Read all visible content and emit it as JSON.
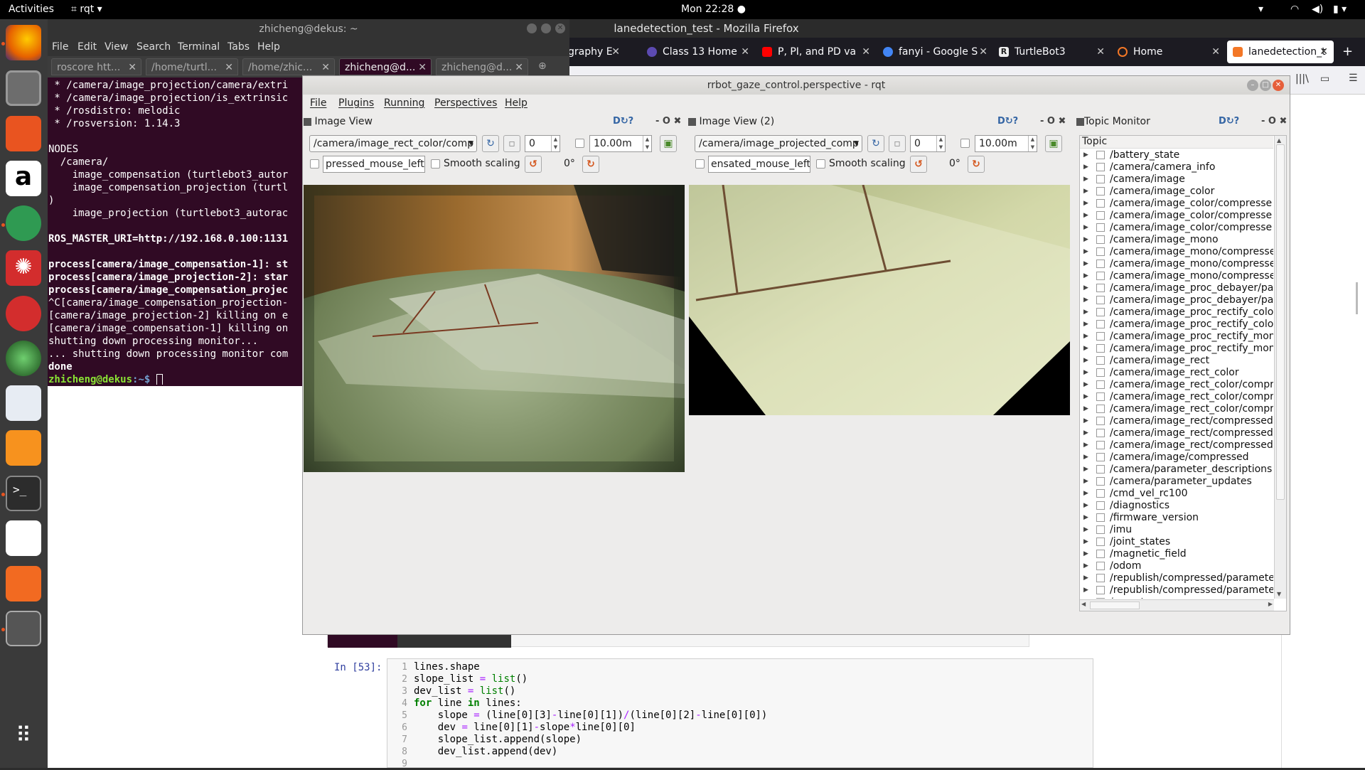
{
  "topbar": {
    "activities": "Activities",
    "app": "rqt",
    "clock": "Mon 22:28 ●"
  },
  "dock": {
    "items": [
      {
        "name": "firefox-icon",
        "color": "#e66000"
      },
      {
        "name": "files-icon",
        "color": "#8a8a8a"
      },
      {
        "name": "software-center-icon",
        "color": "#e95420"
      },
      {
        "name": "amazon-icon",
        "color": "#ffffff"
      },
      {
        "name": "atom-icon",
        "color": "#2f9a52"
      },
      {
        "name": "wolfram-icon",
        "color": "#d32d2d"
      },
      {
        "name": "pdf-reader-icon",
        "color": "#d32d2d"
      },
      {
        "name": "globe-icon",
        "color": "#2d6a2d"
      },
      {
        "name": "gedit-icon",
        "color": "#4a90d9"
      },
      {
        "name": "sublime-icon",
        "color": "#f7921e"
      },
      {
        "name": "terminal-icon",
        "color": "#2c2c2c"
      },
      {
        "name": "text-editor-icon",
        "color": "#ffffff"
      },
      {
        "name": "slides-icon",
        "color": "#f26a21"
      },
      {
        "name": "app-grid-icon",
        "color": "#dddddd"
      }
    ],
    "show_apps": "show-applications-icon"
  },
  "firefox": {
    "title": "lanedetection_test - Mozilla Firefox",
    "tabs": [
      {
        "label": "graphy E",
        "fav": "#666666"
      },
      {
        "label": "Class 13 Home",
        "fav": "#5c4ab1"
      },
      {
        "label": "P, PI, and PD va",
        "fav": "#ff0000"
      },
      {
        "label": "fanyi - Google S",
        "fav": "#4285f4"
      },
      {
        "label": "TurtleBot3",
        "fav": "#222222"
      },
      {
        "label": "Home",
        "fav": "#f37726"
      },
      {
        "label": "lanedetection_t",
        "fav": "#f37726"
      }
    ]
  },
  "terminal": {
    "title": "zhicheng@dekus: ~",
    "menu": [
      "File",
      "Edit",
      "View",
      "Search",
      "Terminal",
      "Tabs",
      "Help"
    ],
    "tabs": [
      "roscore htt...",
      "/home/turtl...",
      "/home/zhic...",
      "zhicheng@d...",
      "zhicheng@d..."
    ],
    "lines": [
      " * /camera/image_projection/camera/extri",
      " * /camera/image_projection/is_extrinsic",
      " * /rosdistro: melodic",
      " * /rosversion: 1.14.3",
      "",
      "NODES",
      "  /camera/",
      "    image_compensation (turtlebot3_autor",
      "    image_compensation_projection (turtl",
      ")",
      "    image_projection (turtlebot3_autorac",
      "",
      "ROS_MASTER_URI=http://192.168.0.100:1131",
      "",
      "process[camera/image_compensation-1]: st",
      "process[camera/image_projection-2]: star",
      "process[camera/image_compensation_projec",
      "^C[camera/image_compensation_projection-",
      "[camera/image_projection-2] killing on e",
      "[camera/image_compensation-1] killing on",
      "shutting down processing monitor...",
      "... shutting down processing monitor com",
      "done"
    ],
    "prompt_user": "zhicheng@dekus",
    "prompt_path": ":~$ "
  },
  "rqt": {
    "title": "rrbot_gaze_control.perspective - rqt",
    "menu": [
      "File",
      "Plugins",
      "Running",
      "Perspectives",
      "Help"
    ],
    "panel1": {
      "title": "Image View",
      "topic": "/camera/image_rect_color/comp",
      "spin": "0",
      "range": "10.00m",
      "mouse_topic": "pressed_mouse_left",
      "smooth": "Smooth scaling",
      "rotation": "0°"
    },
    "panel2": {
      "title": "Image View (2)",
      "topic": "/camera/image_projected_comp",
      "spin": "0",
      "range": "10.00m",
      "mouse_topic": "ensated_mouse_left",
      "smooth": "Smooth scaling",
      "rotation": "0°"
    },
    "panel_controls": "D↻? - O ✖",
    "topic_monitor": {
      "title": "Topic Monitor",
      "header": "Topic",
      "topics": [
        "/battery_state",
        "/camera/camera_info",
        "/camera/image",
        "/camera/image_color",
        "/camera/image_color/compresse",
        "/camera/image_color/compresse",
        "/camera/image_color/compresse",
        "/camera/image_mono",
        "/camera/image_mono/compresse",
        "/camera/image_mono/compresse",
        "/camera/image_mono/compresse",
        "/camera/image_proc_debayer/par",
        "/camera/image_proc_debayer/par",
        "/camera/image_proc_rectify_colo",
        "/camera/image_proc_rectify_colo",
        "/camera/image_proc_rectify_mon",
        "/camera/image_proc_rectify_mon",
        "/camera/image_rect",
        "/camera/image_rect_color",
        "/camera/image_rect_color/compr",
        "/camera/image_rect_color/compr",
        "/camera/image_rect_color/compr",
        "/camera/image_rect/compressed",
        "/camera/image_rect/compressed/",
        "/camera/image_rect/compressed/",
        "/camera/image/compressed",
        "/camera/parameter_descriptions",
        "/camera/parameter_updates",
        "/cmd_vel_rc100",
        "/diagnostics",
        "/firmware_version",
        "/imu",
        "/joint_states",
        "/magnetic_field",
        "/odom",
        "/republish/compressed/paramete",
        "/republish/compressed/paramete",
        "/rosout"
      ]
    }
  },
  "notebook": {
    "prompt": "In [53]:",
    "line_numbers": [
      "1",
      "2",
      "3",
      "4",
      "5",
      "6",
      "7",
      "8",
      "9"
    ]
  }
}
